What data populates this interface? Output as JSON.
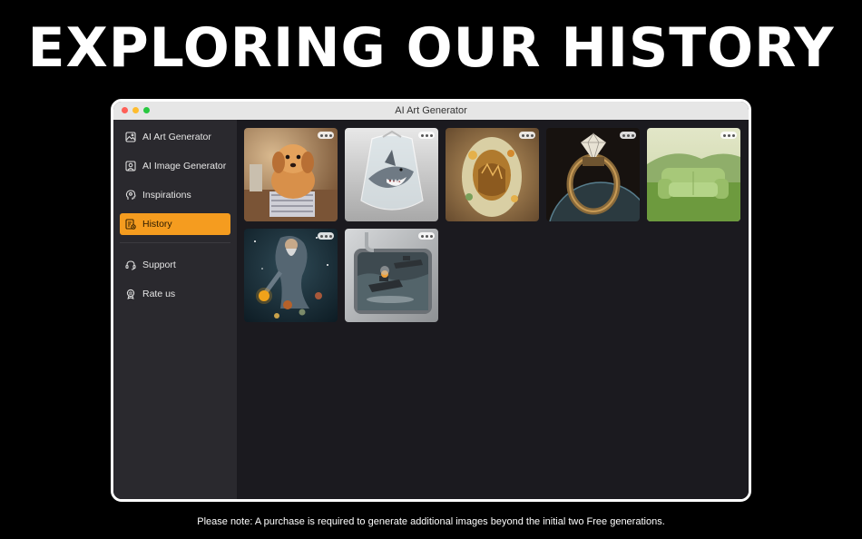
{
  "headline": "EXPLORING OUR HISTORY",
  "window": {
    "title": "AI Art Generator",
    "traffic_lights": [
      "#ff5f57",
      "#febc2e",
      "#28c840"
    ]
  },
  "sidebar": {
    "items": [
      {
        "label": "AI Art Generator",
        "icon": "image-frame-icon"
      },
      {
        "label": "AI Image Generator",
        "icon": "portrait-frame-icon"
      },
      {
        "label": "Inspirations",
        "icon": "lightbulb-head-icon"
      },
      {
        "label": "History",
        "icon": "history-list-icon",
        "active": true
      },
      {
        "label": "Support",
        "icon": "headset-icon"
      },
      {
        "label": "Rate us",
        "icon": "badge-star-icon"
      }
    ],
    "active_color": "#f59c1f"
  },
  "history": {
    "images": [
      {
        "subject": "puppy-sewing"
      },
      {
        "subject": "shark-in-plastic-bag"
      },
      {
        "subject": "painted-egg"
      },
      {
        "subject": "diamond-ring-planet"
      },
      {
        "subject": "grass-sofa-landscape"
      },
      {
        "subject": "wizard-with-planets"
      },
      {
        "subject": "battleships-in-sink"
      }
    ]
  },
  "footer_note": "Please note: A purchase is required to generate additional images beyond the initial two Free generations."
}
